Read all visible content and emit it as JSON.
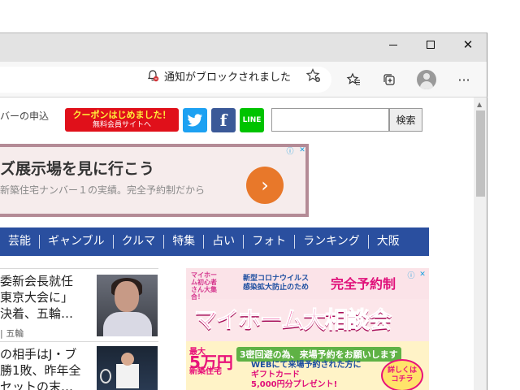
{
  "window": {
    "minimize_label": "─",
    "close_label": "✕"
  },
  "toolbar": {
    "blocked_notice": "通知がブロックされました",
    "icons": [
      "bell-slash-icon",
      "favorite-add-icon",
      "favorites-icon",
      "collections-icon",
      "profile-icon",
      "more-icon"
    ],
    "more_label": "···"
  },
  "header": {
    "crumb_text": "バーの申込",
    "coupon_line1": "クーポンはじめました！",
    "coupon_line2": "無料会員サイトへ",
    "twitter_label": "t",
    "facebook_label": "f",
    "line_label": "LINE",
    "search_placeholder": "",
    "search_button": "検索"
  },
  "banner": {
    "headline": "ズ展示場を見に行こう",
    "subline": "新築住宅ナンバー１の実績。完全予約制だから",
    "arrow": "›"
  },
  "nav": {
    "items": [
      "芸能",
      "ギャンブル",
      "クルマ",
      "特集",
      "占い",
      "フォト",
      "ランキング",
      "大阪"
    ]
  },
  "news": {
    "item1_line1": "委新会長就任",
    "item1_line2": "東京大会に」",
    "item1_line3": "決着、五輪…",
    "item1_tag": "| 五輪",
    "item2_line1": "の相手はJ・ブ",
    "item2_line2": "勝1敗、昨年全",
    "item2_line3": "セットの末…"
  },
  "ad": {
    "mascot_text": "マイホーム初心者さん大集合！",
    "mid_line1": "新型コロナウイルス",
    "mid_line2": "感染拡大防止のため",
    "reserve": "完全予約制",
    "big_title": "マイホーム大相談会",
    "yen_top": "最大",
    "yen_amount": "5万円",
    "yen_bottom": "新築住宅",
    "mitsu": "3密回避の為、来場予約をお願いします",
    "web_line1": "WEBにて来場予約された方に",
    "web_gift": "ギフトカード",
    "web_line3": "5,000円分プレゼント!",
    "detail_line1": "詳しくは",
    "detail_line2": "コチラ"
  },
  "colors": {
    "nav_bg": "#2a4f9f",
    "coupon_bg": "#e0101a",
    "twitter": "#1da1f2",
    "facebook": "#3b5998",
    "line": "#00c300",
    "banner_arrow": "#e8782a"
  }
}
